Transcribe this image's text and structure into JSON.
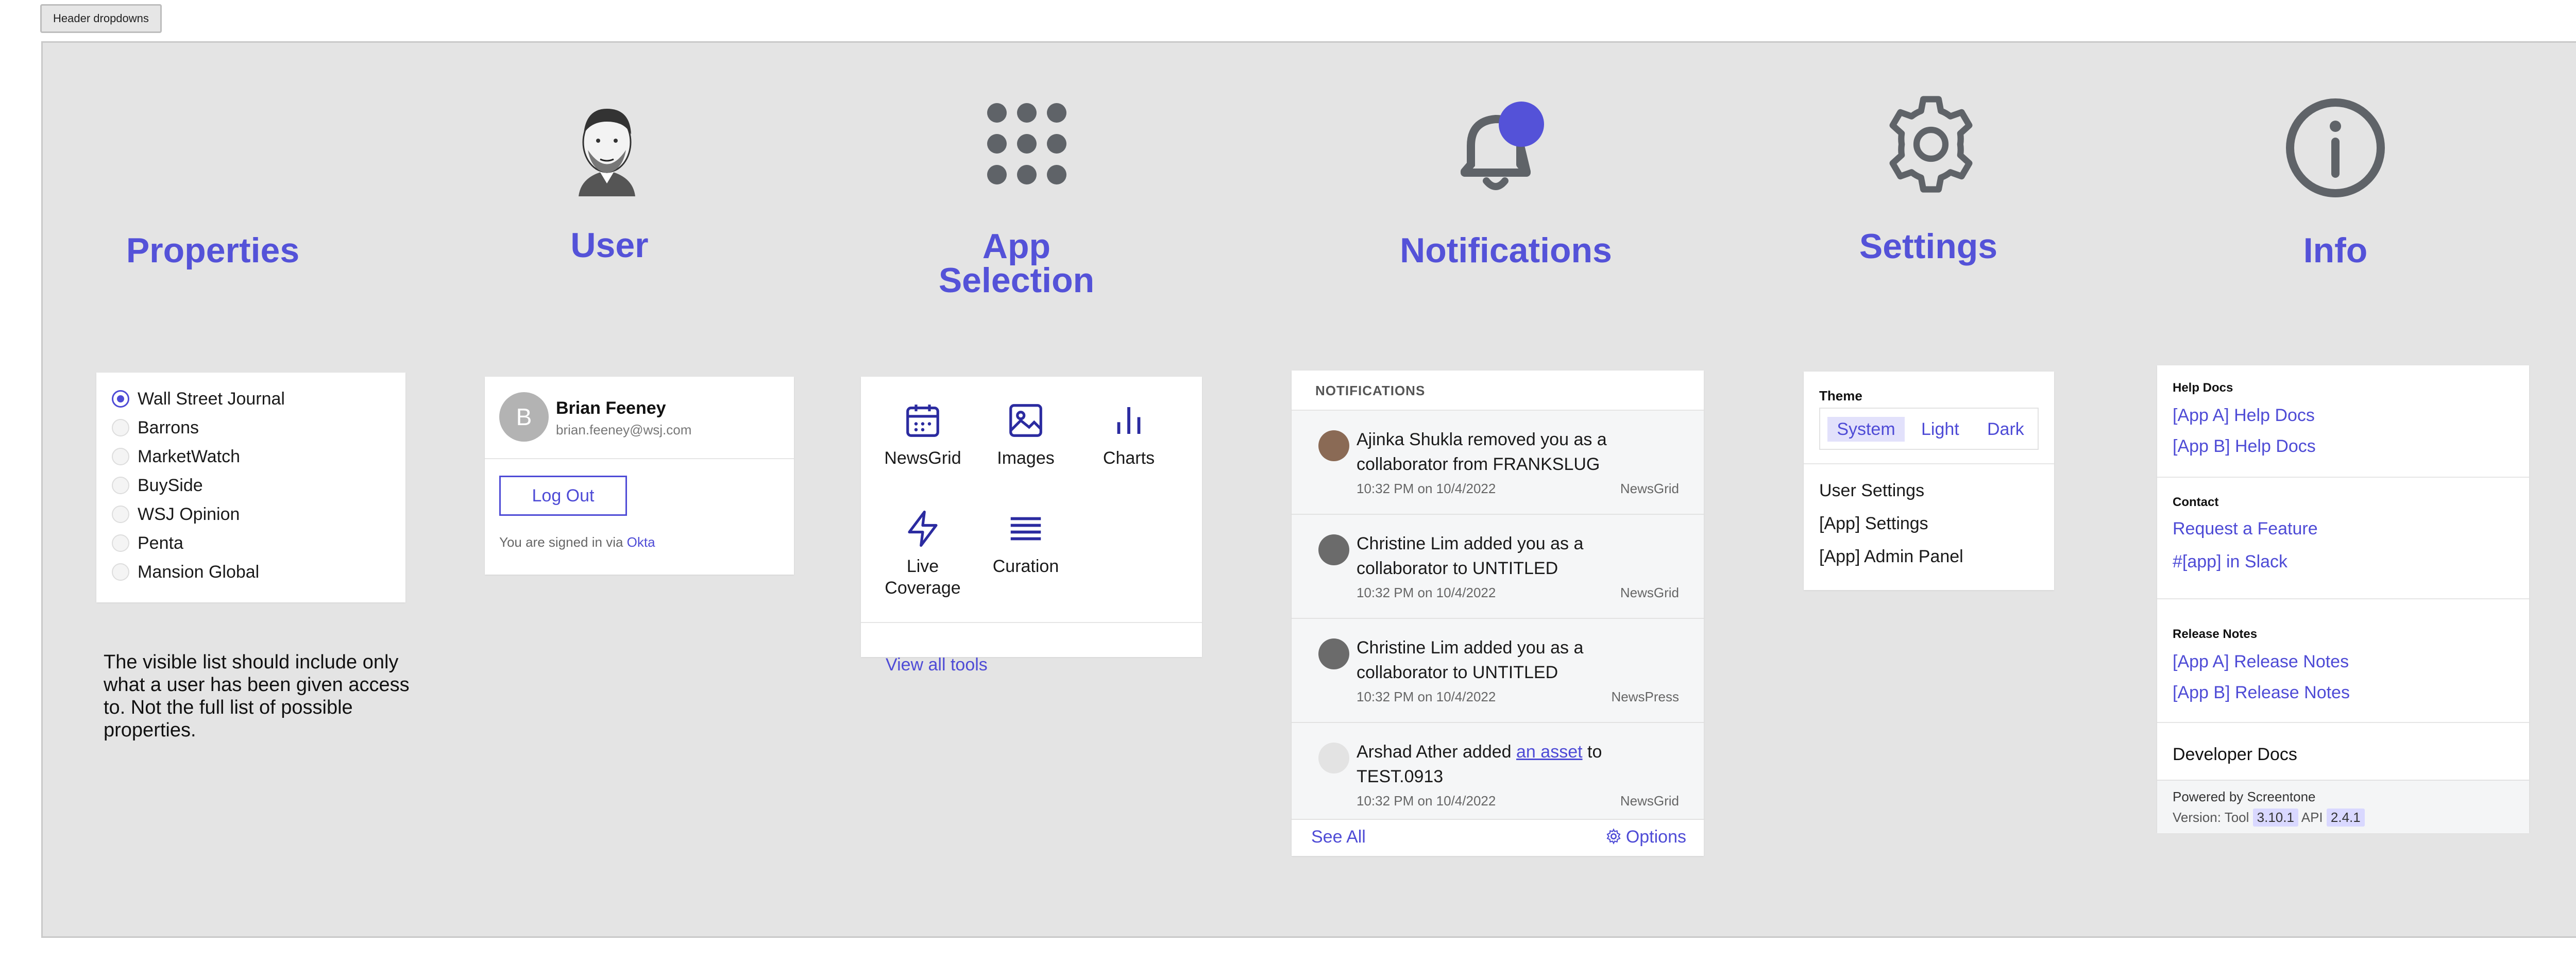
{
  "header_button": "Header dropdowns",
  "titles": {
    "properties": "Properties",
    "user": "User",
    "app_selection_1": "App",
    "app_selection_2": "Selection",
    "notifications": "Notifications",
    "settings": "Settings",
    "info": "Info"
  },
  "properties": {
    "items": [
      "Wall Street Journal",
      "Barrons",
      "MarketWatch",
      "BuySide",
      "WSJ Opinion",
      "Penta",
      "Mansion Global"
    ],
    "selected": "Wall Street Journal",
    "note": "The visible list should include only what a user has been given access to. Not the full list of possible properties."
  },
  "user": {
    "initial": "B",
    "name": "Brian Feeney",
    "email": "brian.feeney@wsj.com",
    "logout": "Log Out",
    "signed_in_prefix": "You are signed in via ",
    "signed_in_provider": "Okta"
  },
  "apps": {
    "tools": [
      "NewsGrid",
      "Images",
      "Charts",
      "Live Coverage",
      "Curation"
    ],
    "view_all": "View all tools"
  },
  "notifications": {
    "header": "NOTIFICATIONS",
    "items": [
      {
        "text": "Ajinka Shukla removed you as a collaborator from FRANKSLUG",
        "time": "10:32 PM on 10/4/2022",
        "app": "NewsGrid"
      },
      {
        "text": "Christine Lim added you as a collaborator to UNTITLED",
        "time": "10:32 PM on 10/4/2022",
        "app": "NewsGrid"
      },
      {
        "text": "Christine Lim added you as a collaborator to UNTITLED",
        "time": "10:32 PM on 10/4/2022",
        "app": "NewsPress"
      },
      {
        "text_pre": "Arshad Ather added ",
        "text_link": "an asset",
        "text_post": " to TEST.0913",
        "time": "10:32 PM on 10/4/2022",
        "app": "NewsGrid"
      }
    ],
    "see_all": "See All",
    "options": "Options"
  },
  "settings": {
    "theme_label": "Theme",
    "theme_options": [
      "System",
      "Light",
      "Dark"
    ],
    "theme_selected": "System",
    "links": [
      "User Settings",
      "[App] Settings",
      "[App] Admin Panel"
    ]
  },
  "info": {
    "help_docs_header": "Help Docs",
    "help_docs": [
      "[App A] Help Docs",
      "[App B] Help Docs"
    ],
    "contact_header": "Contact",
    "contact": [
      "Request a Feature",
      "#[app] in Slack"
    ],
    "release_header": "Release Notes",
    "release": [
      "[App A] Release Notes",
      "[App B] Release Notes"
    ],
    "developer_docs": "Developer Docs",
    "powered_by": "Powered by Screentone",
    "version_label": "Version: Tool",
    "tool_version": "3.10.1",
    "api_label": "API",
    "api_version": "2.4.1"
  },
  "colors": {
    "accent": "#5452d8",
    "canvas": "#e4e4e4",
    "icon_gray": "#5f6368"
  }
}
